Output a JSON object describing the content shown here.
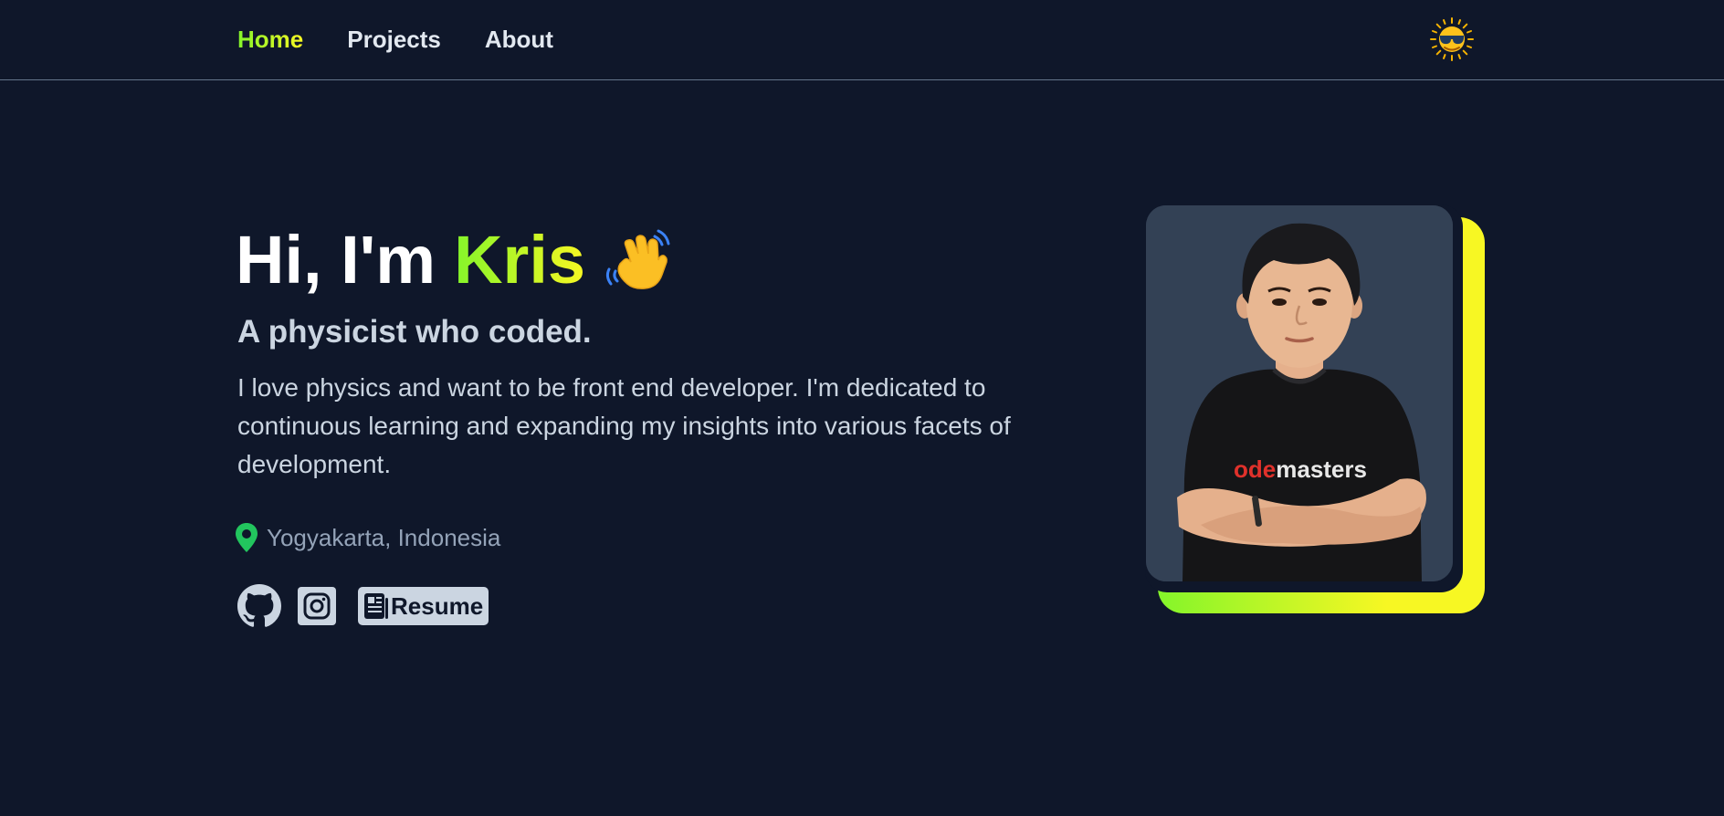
{
  "nav": {
    "links": [
      {
        "label": "Home",
        "active": true
      },
      {
        "label": "Projects",
        "active": false
      },
      {
        "label": "About",
        "active": false
      }
    ],
    "theme_toggle_icon": "sun-with-sunglasses-icon"
  },
  "hero": {
    "greeting": "Hi, I'm",
    "name": "Kris",
    "wave_icon": "waving-hand-icon",
    "subtitle": "A physicist who coded.",
    "description": "I love physics and want to be front end developer. I'm dedicated to continuous learning and expanding my insights into various facets of development.",
    "location": "Yogyakarta, Indonesia",
    "location_icon": "map-pin-icon"
  },
  "socials": {
    "github_icon": "github-icon",
    "instagram_icon": "instagram-icon",
    "resume_icon": "newspaper-icon",
    "resume_label": "Resume"
  },
  "portrait": {
    "shirt_text_red": "ode",
    "shirt_text_white": "masters"
  },
  "colors": {
    "background": "#0f172a",
    "accent_green": "#84f52a",
    "accent_yellow": "#f7f723",
    "text_light": "#cbd5e1",
    "text_muted": "#94a3b8",
    "location_pin": "#22c55e"
  }
}
